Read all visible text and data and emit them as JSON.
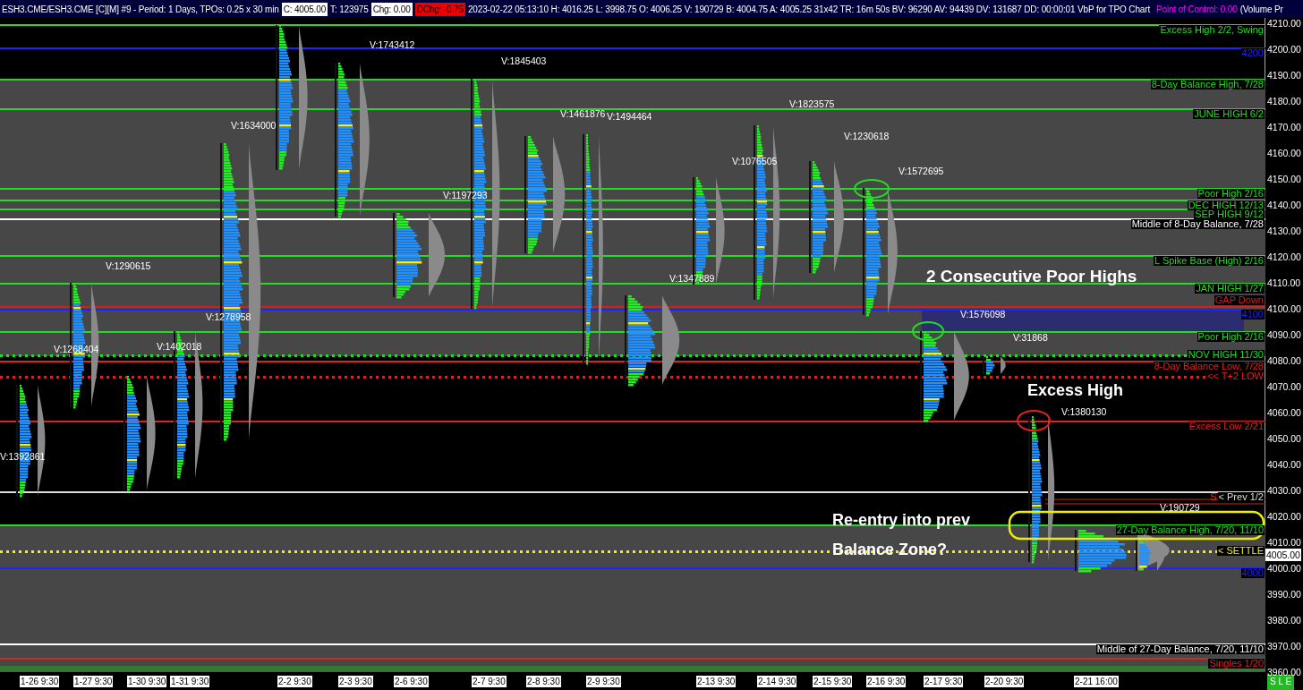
{
  "header": [
    {
      "text": "ESH3.CME/ESH3.CME [C][M]  #9 - Period: 1 Days, TPOs: 0.25 x 30 min",
      "kind": "plain"
    },
    {
      "text": "C: 4005.00",
      "kind": "boxed"
    },
    {
      "text": "T: 123975",
      "kind": "plain"
    },
    {
      "text": "Chg: 0.00",
      "kind": "boxed"
    },
    {
      "text": "DChg: -0.75",
      "kind": "alert"
    },
    {
      "text": "2023-02-22 05:13:10 H: 4016.25 L: 3998.75 O: 4006.25 V: 190729 B: 4004.75 A: 4005.25 31x42 TR: 16m 50s BV: 96290 AV: 94439 DV: 131687 DD: 00:00:01 VbP for TPO Chart",
      "kind": "plain"
    },
    {
      "text": "Point of Control: 0.00",
      "kind": "poc"
    },
    {
      "text": "(Volume Pr",
      "kind": "plain"
    }
  ],
  "levels": [
    {
      "label": "Excess High 2/2, Swing",
      "color": "#22dd22",
      "kind": "solid"
    },
    {
      "label": "4200",
      "color": "#2222ff",
      "kind": "solid"
    },
    {
      "label": "8-Day Balance High, 7/28",
      "color": "#22dd22",
      "kind": "solid"
    },
    {
      "label": "JUNE HIGH 6/2",
      "color": "#22dd22",
      "kind": "solid"
    },
    {
      "label": "Poor High 2/16",
      "color": "#22dd22",
      "kind": "solid"
    },
    {
      "label": "DEC HIGH 12/13",
      "color": "#22dd22",
      "kind": "solid"
    },
    {
      "label": "SEP HIGH 9/12",
      "color": "#22dd22",
      "kind": "solid"
    },
    {
      "label": "Middle of 8-Day Balance, 7/28",
      "color": "#ffffff",
      "kind": "solid"
    },
    {
      "label": "L Spike Base (High) 2/16",
      "color": "#22dd22",
      "kind": "solid"
    },
    {
      "label": "JAN HIGH 1/27",
      "color": "#22dd22",
      "kind": "solid"
    },
    {
      "label": "GAP Down",
      "color": "#cc2222",
      "kind": "solid"
    },
    {
      "label": "4100",
      "color": "#2222ff",
      "kind": "solid"
    },
    {
      "label": "Poor High 2/16",
      "color": "#22dd22",
      "kind": "solid"
    },
    {
      "label": "NOV HIGH 11/30",
      "color": "#22dd22",
      "kind": "dotted"
    },
    {
      "label": "8-Day Balance Low, 7/28",
      "color": "#dd2222",
      "kind": "solid"
    },
    {
      "label": "<< T+2 LOW",
      "color": "#dd2222",
      "kind": "dotted"
    },
    {
      "label": "Excess Low 2/21",
      "color": "#dd2222",
      "kind": "solid"
    },
    {
      "label": "< Prev 1/2",
      "color": "#dddddd",
      "kind": "solid",
      "marker": "S"
    },
    {
      "label": "27-Day Balance High, 7/20, 11/10",
      "color": "#22dd22",
      "kind": "solid"
    },
    {
      "label": "< SETTLE",
      "color": "#eeee22",
      "kind": "dotted"
    },
    {
      "label": "4000",
      "color": "#2222ff",
      "kind": "solid"
    },
    {
      "label": "Middle of 27-Day Balance, 7/20, 11/10",
      "color": "#ffffff",
      "kind": "solid"
    },
    {
      "label": "Singles 1/20",
      "color": "#dd2222",
      "kind": "solid"
    }
  ],
  "volume_labels": [
    "V:1392861",
    "V:1268404",
    "V:1290615",
    "V:1402018",
    "V:1278958",
    "V:1634000",
    "V:1743412",
    "V:1845403",
    "V:1197293",
    "V:1461876",
    "V:1494464",
    "V:1347889",
    "V:1076505",
    "V:1823575",
    "V:1230618",
    "V:1572695",
    "V:1576098",
    "V:31868",
    "V:1380130",
    "V:190729"
  ],
  "annotations": [
    "2 Consecutive Poor Highs",
    "Excess High",
    "Re-entry into prev",
    "Balance Zone?"
  ],
  "price_axis": [
    "4210.00",
    "4200.00",
    "4190.00",
    "4180.00",
    "4170.00",
    "4160.00",
    "4150.00",
    "4140.00",
    "4130.00",
    "4120.00",
    "4110.00",
    "4100.00",
    "4090.00",
    "4080.00",
    "4070.00",
    "4060.00",
    "4050.00",
    "4040.00",
    "4030.00",
    "4020.00",
    "4010.00",
    "4000.00",
    "3990.00",
    "3980.00",
    "3970.00",
    "3960.00"
  ],
  "current_price": "4005.00",
  "dates": [
    "1-26 9:30",
    "1-27 9:30",
    "1-30 9:30",
    "1-31 9:30",
    "2-2 9:30",
    "2-3 9:30",
    "2-6 9:30",
    "2-7 9:30",
    "2-8 9:30",
    "2-9 9:30",
    "2-13 9:30",
    "2-14 9:30",
    "2-15 9:30",
    "2-16 9:30",
    "2-17 9:30",
    "2-20 9:30",
    "2-21 16:00"
  ],
  "corner": "S L E"
}
